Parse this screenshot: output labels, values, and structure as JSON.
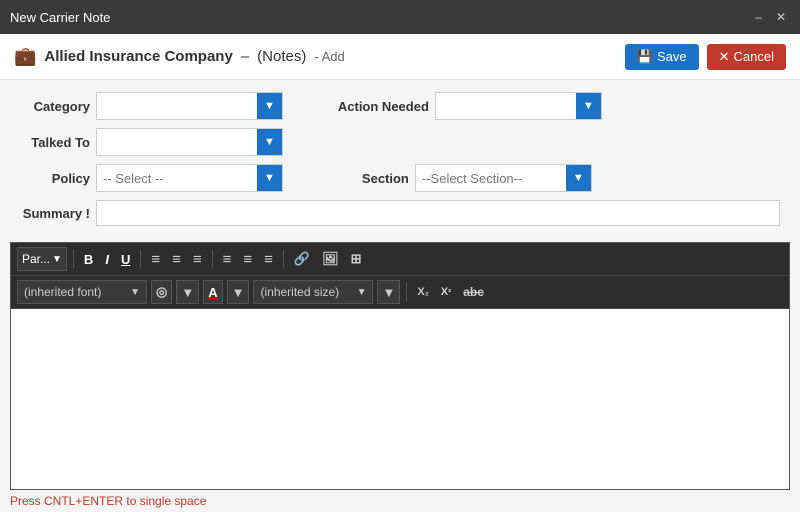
{
  "titleBar": {
    "title": "New Carrier Note",
    "minBtn": "–",
    "closeBtn": "✕"
  },
  "header": {
    "icon": "💼",
    "company": "Allied Insurance Company",
    "separator": "–",
    "section": "(Notes)",
    "action": "- Add",
    "saveLabel": "Save",
    "cancelLabel": "Cancel"
  },
  "form": {
    "categoryLabel": "Category",
    "actionNeededLabel": "Action Needed",
    "talkedToLabel": "Talked To",
    "policyLabel": "Policy",
    "sectionLabel": "Section",
    "summaryLabel": "Summary !",
    "policyPlaceholder": "-- Select --",
    "sectionPlaceholder": "--Select Section--",
    "dropdownArrow": "▼"
  },
  "editor": {
    "paragraphDropdown": "Par...",
    "dropdownArrow": "▼",
    "boldBtn": "B",
    "italicBtn": "I",
    "underlineBtn": "U",
    "alignLeftBtn": "≡",
    "alignCenterBtn": "≡",
    "alignRightBtn": "≡",
    "listUnorderedBtn": "≡",
    "listOrderedBtn": "≡",
    "outdentBtn": "≡",
    "linkBtn": "🔗",
    "imageBtn": "🖼",
    "tableBtn": "⊞",
    "fontFamily": "(inherited font)",
    "fontSpecialBtn": "◎",
    "fontColorBtn": "A",
    "fontSize": "(inherited size)",
    "subscriptBtn": "X₂",
    "superscriptBtn": "X²",
    "strikeBtn": "abc",
    "hintText": "Press CNTL+ENTER to single space"
  }
}
